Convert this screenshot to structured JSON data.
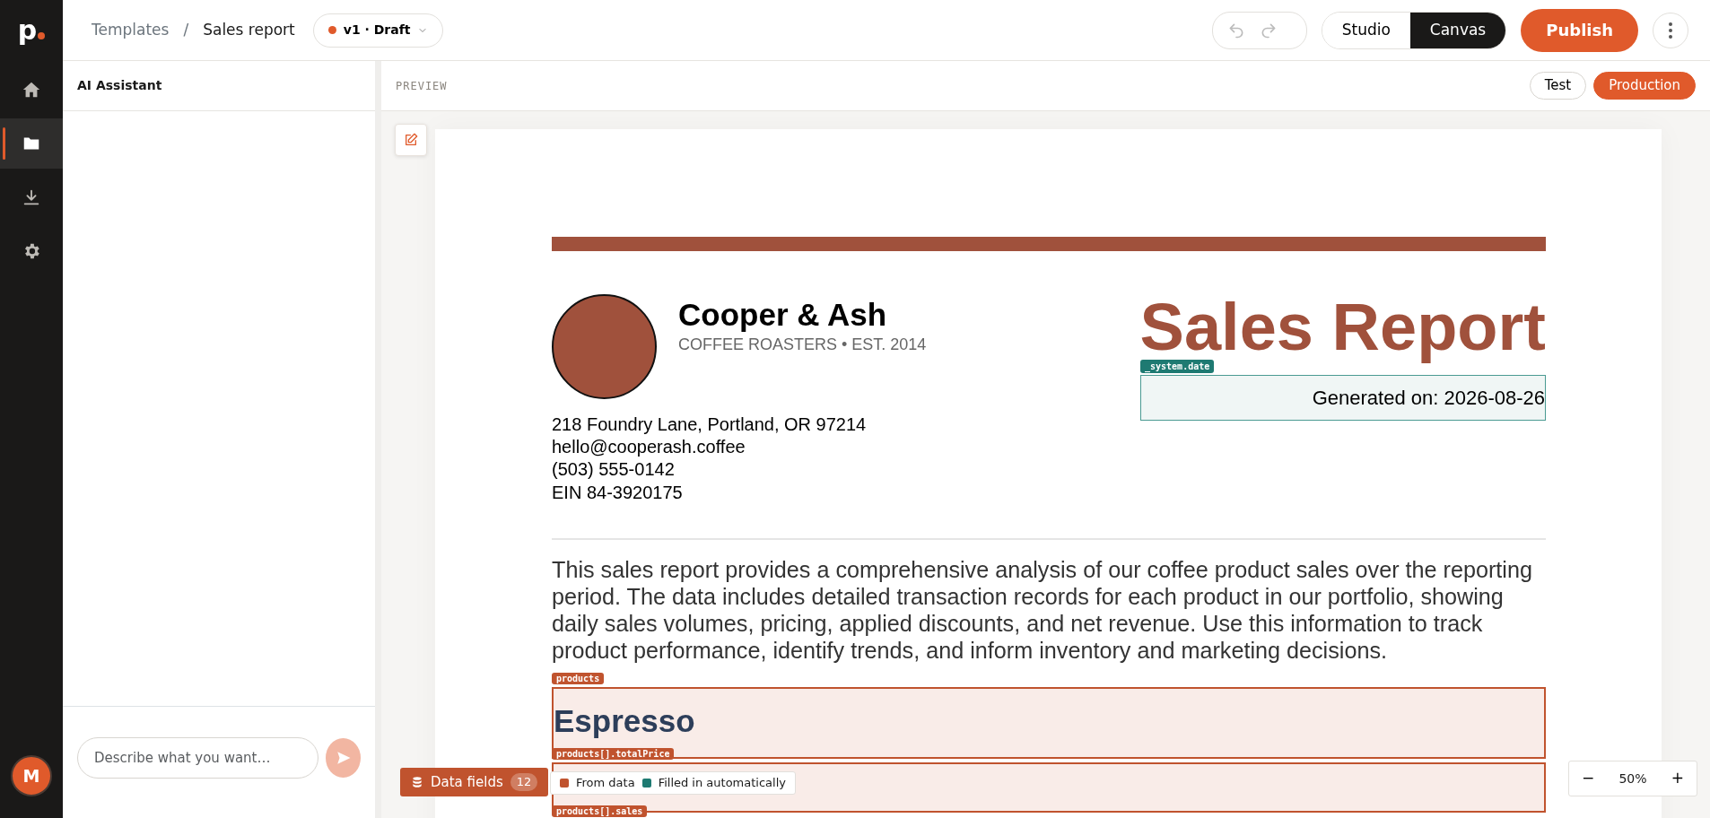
{
  "app": {
    "logo": "p"
  },
  "breadcrumb": [
    {
      "label": "Templates"
    },
    {
      "label": "Sales report"
    }
  ],
  "breadcrumb_separator": "/",
  "version": {
    "label": "v1 · Draft",
    "color": "#e05a2b"
  },
  "view_modes": [
    {
      "label": "Studio",
      "selected": false
    },
    {
      "label": "Canvas",
      "selected": true
    }
  ],
  "publish": "Publish",
  "sidebar": {
    "items": [
      {
        "kind": "home",
        "selected": false
      },
      {
        "kind": "folder",
        "selected": true
      },
      {
        "kind": "download",
        "selected": false
      },
      {
        "kind": "settings",
        "selected": false
      }
    ],
    "avatar": "M"
  },
  "assistant": {
    "title": "AI Assistant",
    "placeholder": "Describe what you want…"
  },
  "preview": {
    "label": "PREVIEW",
    "environments": [
      {
        "label": "Test",
        "selected": false
      },
      {
        "label": "Production",
        "selected": true
      }
    ]
  },
  "document": {
    "company": "Cooper & Ash",
    "tagline": "COFFEE ROASTERS • EST. 2014",
    "address": [
      "218 Foundry Lane, Portland, OR 97214",
      "hello@cooperash.coffee",
      "(503) 555-0142",
      "EIN 84-3920175"
    ],
    "title": "Sales Report",
    "date_tag": "_system.date",
    "date": "Generated on: 2026-08-26",
    "intro": "This sales report provides a comprehensive analysis of our coffee product sales over the reporting period. The data includes detailed transaction records for each product in our portfolio, showing daily sales volumes, pricing, applied discounts, and net revenue. Use this information to track product performance, identify trends, and inform inventory and marketing decisions.",
    "products_tag": "products",
    "product_name": "Espresso",
    "total_tag": "products[].totalPrice",
    "sales_tag": "products[].sales"
  },
  "data_fields": {
    "label": "Data fields",
    "count": "12"
  },
  "legend": [
    {
      "label": "From data",
      "color": "#c0532e"
    },
    {
      "label": "Filled in automatically",
      "color": "#1e7a72"
    }
  ],
  "zoom": {
    "decrease": "−",
    "value": "50%",
    "increase": "+"
  }
}
